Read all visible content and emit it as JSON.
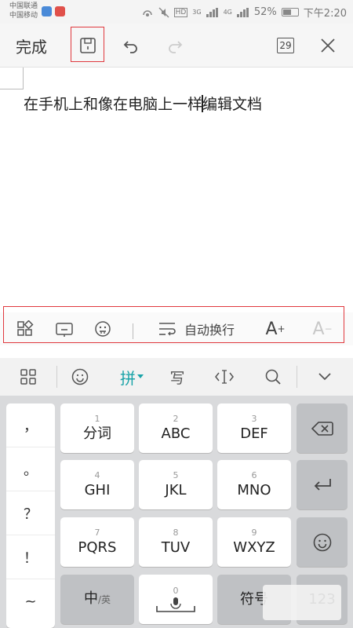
{
  "status_bar": {
    "carrier1": "中国联通",
    "carrier2": "中国移动",
    "net1": "3G",
    "net2": "4G",
    "hd": "HD",
    "battery": "52%",
    "time": "下午2:20"
  },
  "toolbar": {
    "done_label": "完成",
    "page_count": "29"
  },
  "document": {
    "text_before": "在手机上和像在电脑上一样",
    "text_after": "编辑文档"
  },
  "format_bar": {
    "wrap_label": "自动换行",
    "font_up": "A",
    "font_up_sign": "+",
    "font_down": "A",
    "font_down_sign": "−"
  },
  "ime_bar": {
    "pinyin_label": "拼",
    "handwrite_label": "写"
  },
  "keyboard": {
    "punct": [
      "，",
      "。",
      "？",
      "！",
      "~"
    ],
    "keys": [
      {
        "num": "1",
        "label": "分词"
      },
      {
        "num": "2",
        "label": "ABC"
      },
      {
        "num": "3",
        "label": "DEF"
      },
      {
        "num": "4",
        "label": "GHI"
      },
      {
        "num": "5",
        "label": "JKL"
      },
      {
        "num": "6",
        "label": "MNO"
      },
      {
        "num": "7",
        "label": "PQRS"
      },
      {
        "num": "8",
        "label": "TUV"
      },
      {
        "num": "9",
        "label": "WXYZ"
      }
    ],
    "lang_key": "中",
    "lang_sub": "/英",
    "space_num": "0",
    "symbol_key": "符号",
    "num_key": "123"
  },
  "colors": {
    "highlight": "#e0393e",
    "ime_accent": "#19a3a8"
  }
}
